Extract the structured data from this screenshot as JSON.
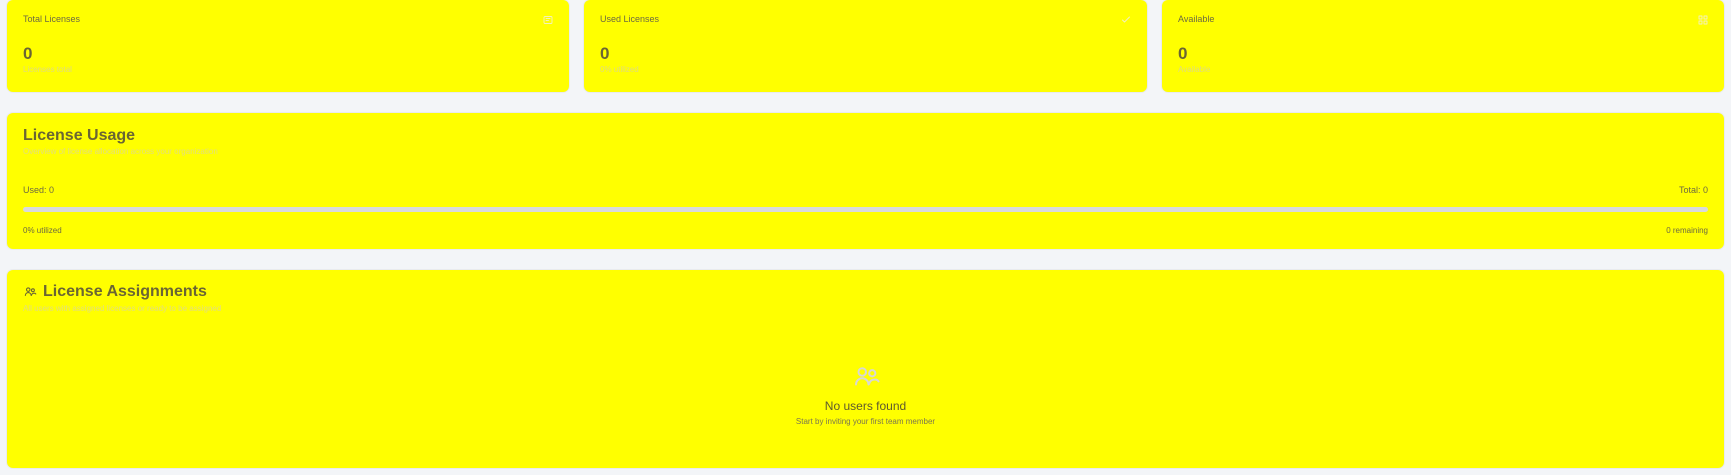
{
  "stats": [
    {
      "title": "Total Licenses",
      "value": "0",
      "subtitle": "Licenses total",
      "icon": "license-icon"
    },
    {
      "title": "Used Licenses",
      "value": "0",
      "subtitle": "0% utilized",
      "icon": "check-icon"
    },
    {
      "title": "Available",
      "value": "0",
      "subtitle": "Available",
      "icon": "grid-icon"
    }
  ],
  "usage": {
    "title": "License Usage",
    "subtitle": "Overview of license allocation across your organization",
    "used_label": "Used: 0",
    "total_label": "Total: 0",
    "utilized_label": "0% utilized",
    "remaining_label": "0 remaining",
    "progress_percent": 0
  },
  "assignments": {
    "title": "License Assignments",
    "subtitle": "All users with assigned licenses or ready to be assigned",
    "empty_title": "No users found",
    "empty_subtitle": "Start by inviting your first team member",
    "header_icon": "users-icon",
    "empty_icon": "users-icon"
  },
  "colors": {
    "card": "#ffff00",
    "background": "#f3f5f8",
    "track": "#d9dadc",
    "muted_text": "#e2dd7d"
  }
}
